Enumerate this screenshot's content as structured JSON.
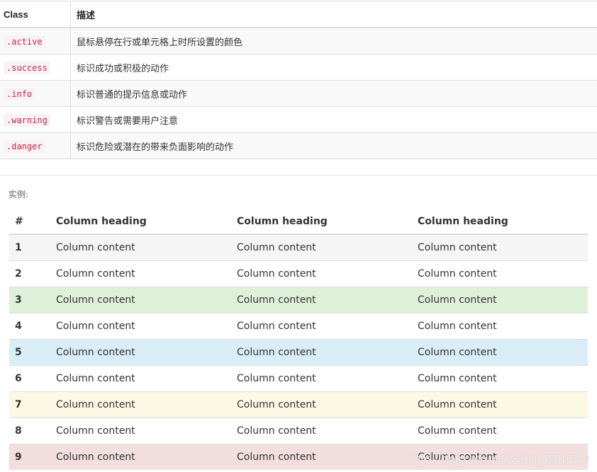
{
  "reference": {
    "headers": {
      "class": "Class",
      "desc": "描述"
    },
    "rows": [
      {
        "cls": ".active",
        "desc": "鼠标悬停在行或单元格上时所设置的颜色"
      },
      {
        "cls": ".success",
        "desc": "标识成功或积极的动作"
      },
      {
        "cls": ".info",
        "desc": "标识普通的提示信息或动作"
      },
      {
        "cls": ".warning",
        "desc": "标识警告或需要用户注意"
      },
      {
        "cls": ".danger",
        "desc": "标识危险或潜在的带来负面影响的动作"
      }
    ]
  },
  "example_label": "实例:",
  "demo": {
    "headers": [
      "#",
      "Column heading",
      "Column heading",
      "Column heading"
    ],
    "rows": [
      {
        "num": "1",
        "c1": "Column content",
        "c2": "Column content",
        "c3": "Column content",
        "state": "active"
      },
      {
        "num": "2",
        "c1": "Column content",
        "c2": "Column content",
        "c3": "Column content",
        "state": ""
      },
      {
        "num": "3",
        "c1": "Column content",
        "c2": "Column content",
        "c3": "Column content",
        "state": "success"
      },
      {
        "num": "4",
        "c1": "Column content",
        "c2": "Column content",
        "c3": "Column content",
        "state": ""
      },
      {
        "num": "5",
        "c1": "Column content",
        "c2": "Column content",
        "c3": "Column content",
        "state": "info"
      },
      {
        "num": "6",
        "c1": "Column content",
        "c2": "Column content",
        "c3": "Column content",
        "state": ""
      },
      {
        "num": "7",
        "c1": "Column content",
        "c2": "Column content",
        "c3": "Column content",
        "state": "warning"
      },
      {
        "num": "8",
        "c1": "Column content",
        "c2": "Column content",
        "c3": "Column content",
        "state": ""
      },
      {
        "num": "9",
        "c1": "Column content",
        "c2": "Column content",
        "c3": "Column content",
        "state": "danger"
      }
    ]
  },
  "colors": {
    "active": "#f5f5f5",
    "success": "#dff0d8",
    "info": "#d9edf7",
    "warning": "#fcf8e3",
    "danger": "#f2dede",
    "code_text": "#c7254e",
    "code_bg": "#f9f2f4"
  },
  "watermark": "https://blog.csdn.net/weixin_45810319"
}
